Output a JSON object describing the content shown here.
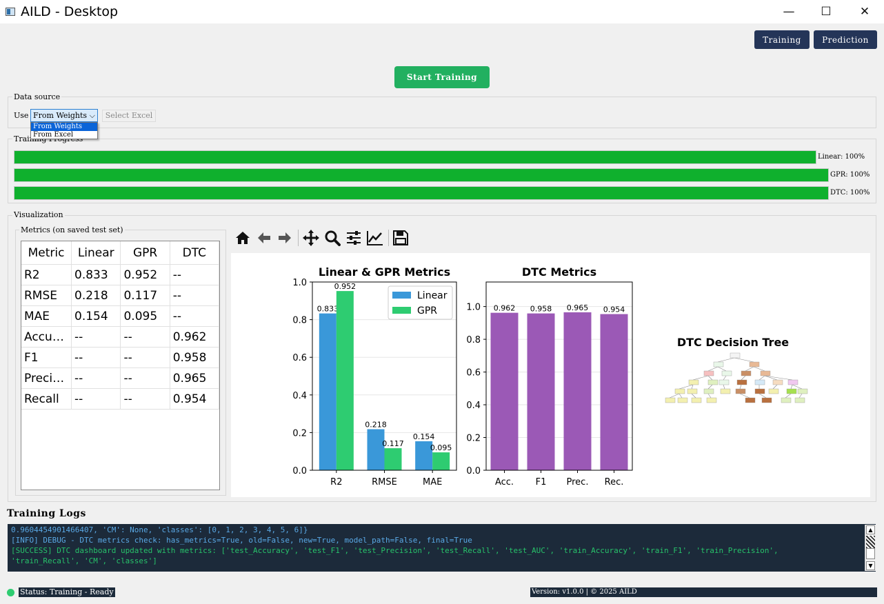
{
  "window": {
    "title": "AILD - Desktop",
    "minimize": "—",
    "maximize": "☐",
    "close": "✕"
  },
  "nav": {
    "training_label": "Training",
    "prediction_label": "Prediction"
  },
  "start_button": "Start Training",
  "data_source": {
    "group_title": "Data source",
    "use_label": "Use",
    "selected": "From Weights",
    "options": [
      "From Weights",
      "From Excel"
    ],
    "select_excel_label": "Select Excel"
  },
  "training_progress": {
    "group_title": "Training Progress",
    "bars": [
      {
        "label": "Linear: 100%",
        "value": 1.0
      },
      {
        "label": "GPR: 100%",
        "value": 1.0
      },
      {
        "label": "DTC: 100%",
        "value": 1.0
      }
    ],
    "color": "#0fb02d"
  },
  "visualization": {
    "group_title": "Visualization",
    "metrics_title": "Metrics (on saved test set)",
    "table": {
      "headers": [
        "Metric",
        "Linear",
        "GPR",
        "DTC"
      ],
      "rows": [
        [
          "R2",
          "0.833",
          "0.952",
          "--"
        ],
        [
          "RMSE",
          "0.218",
          "0.117",
          "--"
        ],
        [
          "MAE",
          "0.154",
          "0.095",
          "--"
        ],
        [
          "Accuracy",
          "--",
          "--",
          "0.962"
        ],
        [
          "F1",
          "--",
          "--",
          "0.958"
        ],
        [
          "Precision",
          "--",
          "--",
          "0.965"
        ],
        [
          "Recall",
          "--",
          "--",
          "0.954"
        ]
      ]
    },
    "toolbar": [
      "home-icon",
      "back-icon",
      "forward-icon",
      "pan-icon",
      "zoom-icon",
      "configure-icon",
      "edit-axis-icon",
      "save-icon"
    ]
  },
  "chart_data": [
    {
      "type": "bar",
      "title": "Linear & GPR Metrics",
      "categories": [
        "R2",
        "RMSE",
        "MAE"
      ],
      "series": [
        {
          "name": "Linear",
          "values": [
            0.833,
            0.218,
            0.154
          ],
          "color": "#3a98d9"
        },
        {
          "name": "GPR",
          "values": [
            0.952,
            0.117,
            0.095
          ],
          "color": "#2ecc71"
        }
      ],
      "ylim": [
        0,
        1.0
      ],
      "yticks": [
        "0.0",
        "0.2",
        "0.4",
        "0.6",
        "0.8",
        "1.0"
      ],
      "legend": "top-right",
      "grid": true
    },
    {
      "type": "bar",
      "title": "DTC Metrics",
      "categories": [
        "Acc.",
        "F1",
        "Prec.",
        "Rec."
      ],
      "values": [
        0.962,
        0.958,
        0.965,
        0.954
      ],
      "color": "#9b59b6",
      "ylim": [
        0,
        1.15
      ],
      "yticks": [
        "0.0",
        "0.2",
        "0.4",
        "0.6",
        "0.8",
        "1.0"
      ],
      "grid": true
    }
  ],
  "tree_title": "DTC Decision Tree",
  "logs": {
    "title": "Training Logs",
    "lines": [
      {
        "text": "0.9604454901466407, 'CM': None, 'classes': [0, 1, 2, 3, 4, 5, 6]}",
        "color": "#5aa9e6"
      },
      {
        "text": "[INFO] DEBUG - DTC metrics check: has_metrics=True, old=False, new=True, model_path=False, final=True",
        "color": "#5aa9e6"
      },
      {
        "text": "[SUCCESS] DTC dashboard updated with metrics: ['test_Accuracy', 'test_F1', 'test_Precision', 'test_Recall', 'test_AUC', 'train_Accuracy', 'train_F1', 'train_Precision',",
        "color": "#27c26a"
      },
      {
        "text": "'train_Recall', 'CM', 'classes']",
        "color": "#27c26a"
      }
    ]
  },
  "status": {
    "text": "Status: Training - Ready",
    "dot_color": "#2ecc71",
    "version": "Version: v1.0.0 | © 2025 AILD"
  }
}
